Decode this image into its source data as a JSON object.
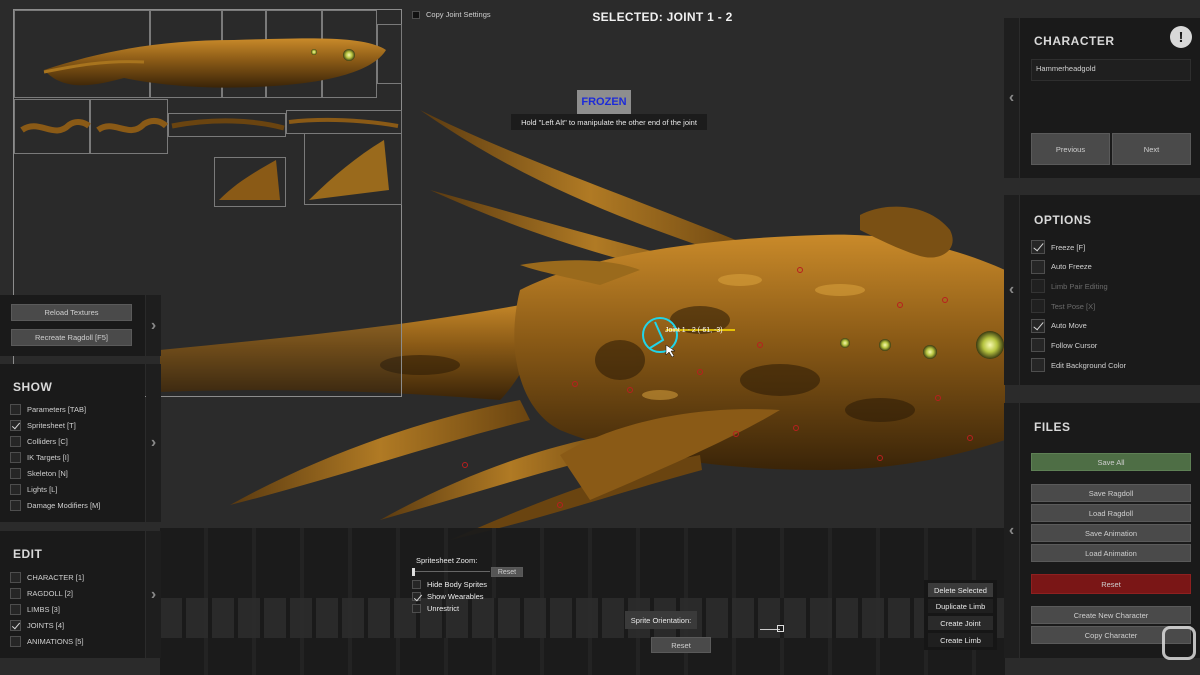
{
  "top": {
    "copy_joint_settings": "Copy Joint Settings",
    "selected_title": "SELECTED: JOINT 1 - 2",
    "frozen_badge": "FROZEN",
    "hint": "Hold \"Left Alt\" to manipulate the other end of the joint"
  },
  "joint_label": "Joint 1 - 2 (-61, -3)",
  "texture_panel": {
    "reload_textures": "Reload Textures",
    "recreate_ragdoll": "Recreate Ragdoll [F5]"
  },
  "show": {
    "title": "SHOW",
    "items": [
      {
        "label": "Parameters [TAB]",
        "checked": false
      },
      {
        "label": "Spritesheet [T]",
        "checked": true
      },
      {
        "label": "Colliders [C]",
        "checked": false
      },
      {
        "label": "IK Targets [I]",
        "checked": false
      },
      {
        "label": "Skeleton [N]",
        "checked": false
      },
      {
        "label": "Lights [L]",
        "checked": false
      },
      {
        "label": "Damage Modifiers [M]",
        "checked": false
      }
    ]
  },
  "edit": {
    "title": "EDIT",
    "items": [
      {
        "label": "CHARACTER [1]",
        "checked": false
      },
      {
        "label": "RAGDOLL [2]",
        "checked": false
      },
      {
        "label": "LIMBS [3]",
        "checked": false
      },
      {
        "label": "JOINTS [4]",
        "checked": true
      },
      {
        "label": "ANIMATIONS [5]",
        "checked": false
      }
    ]
  },
  "character": {
    "title": "CHARACTER",
    "info_glyph": "!",
    "selected_character": "Hammerheadgold",
    "previous": "Previous",
    "next": "Next"
  },
  "options": {
    "title": "OPTIONS",
    "items": [
      {
        "label": "Freeze [F]",
        "checked": true,
        "disabled": false
      },
      {
        "label": "Auto Freeze",
        "checked": false,
        "disabled": false
      },
      {
        "label": "Limb Pair Editing",
        "checked": false,
        "disabled": true
      },
      {
        "label": "Test Pose [X]",
        "checked": false,
        "disabled": true
      },
      {
        "label": "Auto Move",
        "checked": true,
        "disabled": false
      },
      {
        "label": "Follow Cursor",
        "checked": false,
        "disabled": false
      },
      {
        "label": "Edit Background Color",
        "checked": false,
        "disabled": false
      }
    ]
  },
  "files": {
    "title": "FILES",
    "save_all": "Save All",
    "save_ragdoll": "Save Ragdoll",
    "load_ragdoll": "Load Ragdoll",
    "save_animation": "Save Animation",
    "load_animation": "Load Animation",
    "reset": "Reset",
    "create_new_character": "Create New Character",
    "copy_character": "Copy Character"
  },
  "spritesheet_controls": {
    "zoom_label": "Spritesheet Zoom:",
    "zoom_reset": "Reset",
    "hide_body_sprites": {
      "label": "Hide Body Sprites",
      "checked": false
    },
    "show_wearables": {
      "label": "Show Wearables",
      "checked": true
    },
    "unrestrict": {
      "label": "Unrestrict",
      "checked": false
    }
  },
  "orientation": {
    "label": "Sprite Orientation:",
    "reset": "Reset"
  },
  "joint_actions": {
    "delete_selected": "Delete Selected",
    "duplicate_limb": "Duplicate Limb",
    "create_joint": "Create Joint",
    "create_limb": "Create Limb"
  },
  "colors": {
    "save_all_green": "#4e6e45",
    "reset_red": "#7a1616",
    "frozen_text": "#1d2bd8",
    "joint_cyan": "#21d4e8"
  }
}
